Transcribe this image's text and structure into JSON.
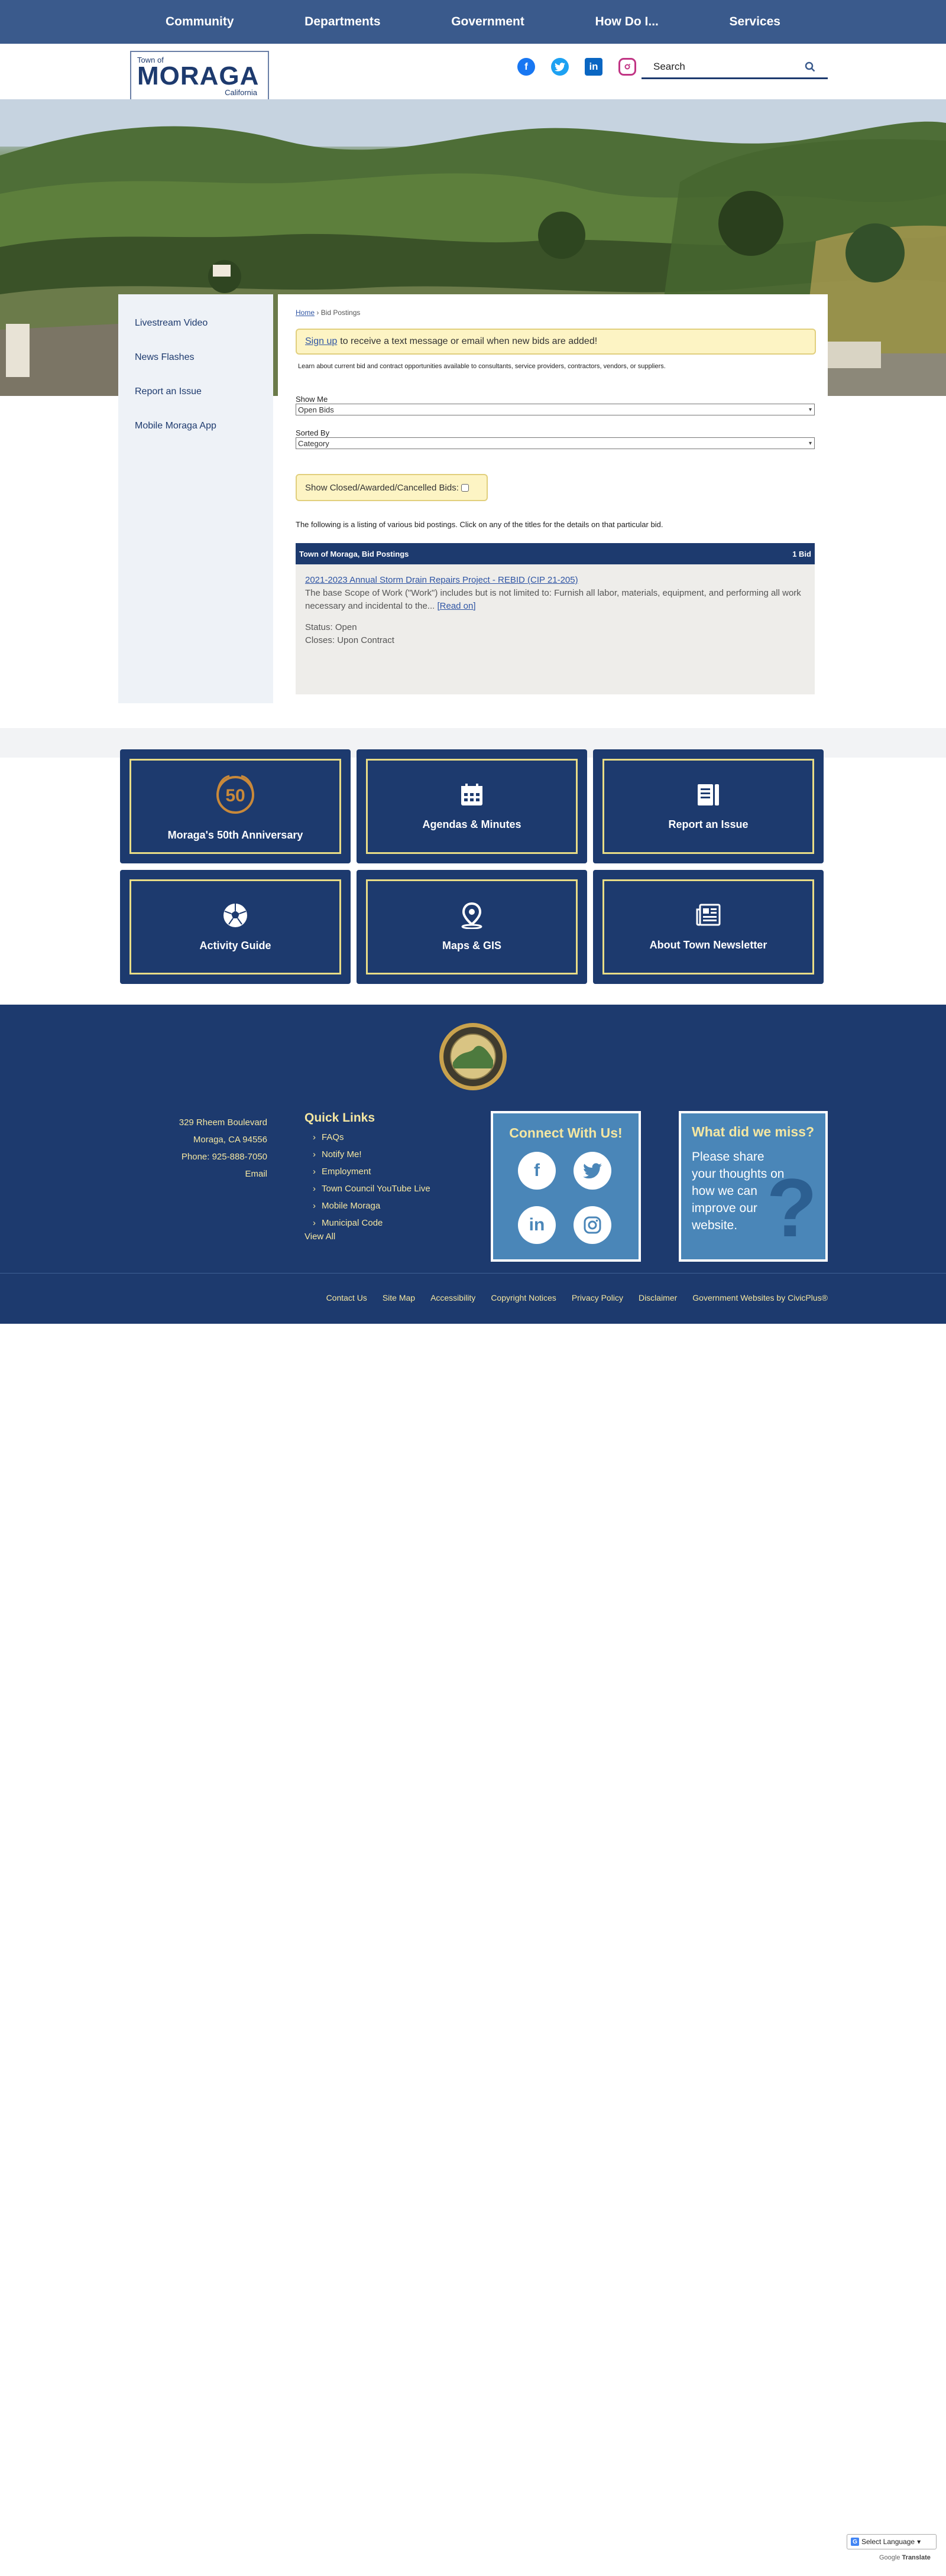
{
  "nav": {
    "items": [
      "Community",
      "Departments",
      "Government",
      "How Do I...",
      "Services"
    ]
  },
  "header": {
    "logo_town": "Town of",
    "logo_name": "MORAGA",
    "logo_state": "California",
    "social_icons": [
      "facebook-icon",
      "twitter-icon",
      "linkedin-icon",
      "instagram-icon"
    ],
    "search_placeholder": "Search"
  },
  "sidebar": {
    "items": [
      "Livestream Video",
      "News Flashes",
      "Report an Issue",
      "Mobile Moraga App"
    ]
  },
  "main": {
    "breadcrumb_home": "Home",
    "breadcrumb_sep": "›",
    "breadcrumb_current": "Bid Postings",
    "signup_link": "Sign up",
    "signup_text": "to receive a text message or email when new bids are added!",
    "learn_text": "Learn about current bid and contract opportunities available to consultants, service providers, contractors, vendors, or suppliers.",
    "show_me_label": "Show Me",
    "show_me_value": "Open Bids",
    "sorted_by_label": "Sorted By",
    "sorted_by_value": "Category",
    "show_closed_label": "Show Closed/Awarded/Cancelled Bids:",
    "listing_text": "The following is a listing of various bid postings. Click on any of the titles for the details on that particular bid.",
    "bid_header_title": "Town of Moraga, Bid Postings",
    "bid_header_count": "1 Bid",
    "bid": {
      "title": "2021-2023 Annual Storm Drain Repairs Project - REBID (CIP 21-205)",
      "description": "The base Scope of Work (\"Work\") includes but is not limited to: Furnish all labor, materials, equipment, and performing all work necessary and incidental to the...",
      "read_on": "[Read on]",
      "status_label": "Status:",
      "status_value": "Open",
      "closes_label": "Closes:",
      "closes_value": "Upon Contract"
    }
  },
  "tiles": [
    {
      "label": "Moraga's 50th Anniversary",
      "icon": "anniversary-50-icon",
      "badge": "50"
    },
    {
      "label": "Agendas & Minutes",
      "icon": "calendar-icon"
    },
    {
      "label": "Report an Issue",
      "icon": "report-icon"
    },
    {
      "label": "Activity Guide",
      "icon": "soccer-ball-icon"
    },
    {
      "label": "Maps & GIS",
      "icon": "map-pin-icon"
    },
    {
      "label": "About Town Newsletter",
      "icon": "newspaper-icon"
    }
  ],
  "footer": {
    "address": [
      "329 Rheem Boulevard",
      "Moraga, CA 94556",
      "Phone: 925-888-7050",
      "Email"
    ],
    "quick_links_title": "Quick Links",
    "quick_links": [
      "FAQs",
      "Notify Me!",
      "Employment",
      "Town Council YouTube Live",
      "Mobile Moraga",
      "Municipal Code"
    ],
    "view_all": "View All",
    "connect_title": "Connect With Us!",
    "connect_icons": [
      "facebook-icon",
      "twitter-icon",
      "linkedin-icon",
      "instagram-icon"
    ],
    "miss_title": "What did we miss?",
    "miss_text": "Please share your thoughts on how we can improve our website.",
    "links": [
      "Contact Us",
      "Site Map",
      "Accessibility",
      "Copyright Notices",
      "Privacy Policy",
      "Disclaimer",
      "Government Websites by CivicPlus®"
    ]
  },
  "translate": {
    "select_label": "Select Language",
    "powered": "Google",
    "translate_word": "Translate"
  },
  "colors": {
    "nav_bg": "#3a5a8c",
    "brand_navy": "#1d3a6e",
    "accent_yellow": "#f5e7a1",
    "notice_bg": "#fdf4c4",
    "footer_panel_blue": "#4a86b8"
  }
}
